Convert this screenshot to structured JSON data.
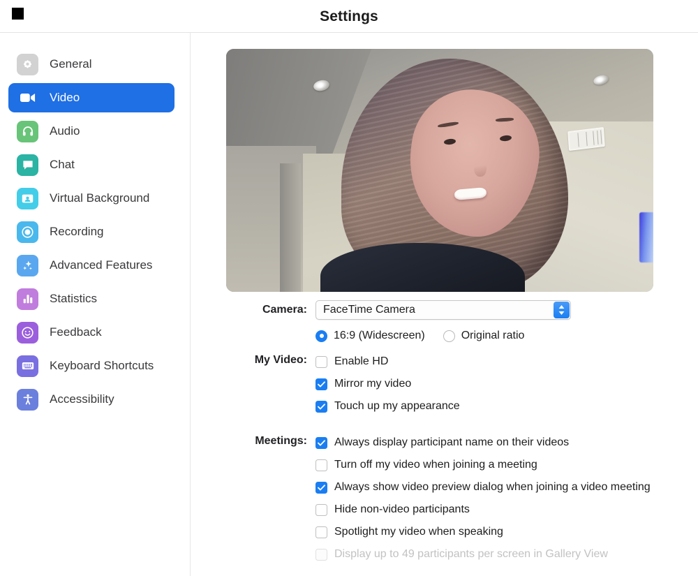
{
  "window": {
    "title": "Settings",
    "control_icon": "window-control-square"
  },
  "sidebar": {
    "items": [
      {
        "label": "General",
        "icon": "gear-icon",
        "color": "#d2d2d2",
        "active": false
      },
      {
        "label": "Video",
        "icon": "video-camera-icon",
        "color": "#1f6fe5",
        "active": true
      },
      {
        "label": "Audio",
        "icon": "headphones-icon",
        "color": "#68c478",
        "active": false
      },
      {
        "label": "Chat",
        "icon": "chat-bubble-icon",
        "color": "#2bb3a3",
        "active": false
      },
      {
        "label": "Virtual Background",
        "icon": "person-card-icon",
        "color": "#43cde8",
        "active": false
      },
      {
        "label": "Recording",
        "icon": "record-circle-icon",
        "color": "#4ab8ec",
        "active": false
      },
      {
        "label": "Advanced Features",
        "icon": "sparkles-icon",
        "color": "#5aa7ef",
        "active": false
      },
      {
        "label": "Statistics",
        "icon": "bar-chart-icon",
        "color": "#c07ddd",
        "active": false
      },
      {
        "label": "Feedback",
        "icon": "smiley-face-icon",
        "color": "#9b5fdd",
        "active": false
      },
      {
        "label": "Keyboard Shortcuts",
        "icon": "keyboard-icon",
        "color": "#7a6fe0",
        "active": false
      },
      {
        "label": "Accessibility",
        "icon": "accessibility-icon",
        "color": "#6b7fdd",
        "active": false
      }
    ]
  },
  "main": {
    "preview": {
      "alt": "self-view-camera-preview"
    },
    "camera": {
      "label": "Camera:",
      "selected": "FaceTime Camera",
      "options": [
        "FaceTime Camera"
      ],
      "stepper_icon": "chevron-up-down-icon",
      "aspect_ratio": {
        "selected": "16:9 (Widescreen)",
        "options": [
          {
            "label": "16:9 (Widescreen)",
            "checked": true
          },
          {
            "label": "Original ratio",
            "checked": false
          }
        ]
      }
    },
    "my_video": {
      "label": "My Video:",
      "options": [
        {
          "label": "Enable HD",
          "checked": false,
          "disabled": false
        },
        {
          "label": "Mirror my video",
          "checked": true,
          "disabled": false
        },
        {
          "label": "Touch up my appearance",
          "checked": true,
          "disabled": false
        }
      ]
    },
    "meetings": {
      "label": "Meetings:",
      "options": [
        {
          "label": "Always display participant name on their videos",
          "checked": true,
          "disabled": false
        },
        {
          "label": "Turn off my video when joining a meeting",
          "checked": false,
          "disabled": false
        },
        {
          "label": "Always show video preview dialog when joining a video meeting",
          "checked": true,
          "disabled": false
        },
        {
          "label": "Hide non-video participants",
          "checked": false,
          "disabled": false
        },
        {
          "label": "Spotlight my video when speaking",
          "checked": false,
          "disabled": false
        },
        {
          "label": "Display up to 49 participants per screen in Gallery View",
          "checked": false,
          "disabled": true
        }
      ]
    }
  },
  "colors": {
    "accent": "#1a7ef2",
    "active_nav": "#1f6fe5",
    "text": "#1d1d1f",
    "disabled_text": "#c2c2c4"
  }
}
